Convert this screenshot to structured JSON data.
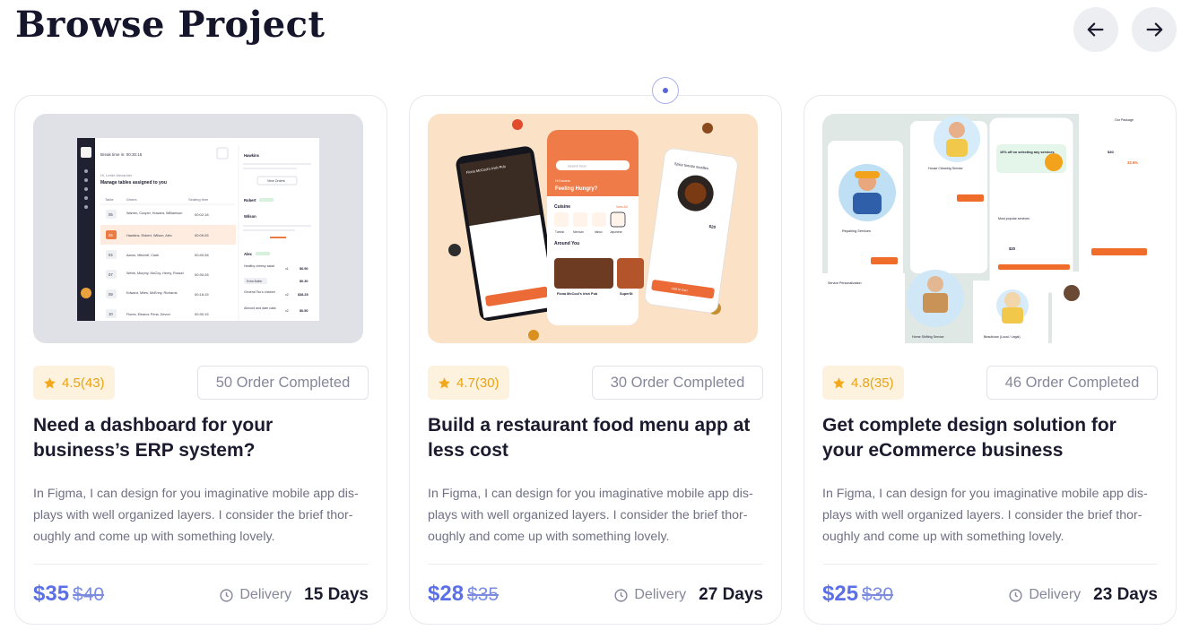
{
  "header": {
    "title": "Browse Project"
  },
  "nav": {
    "prev_icon": "arrow-left-icon",
    "next_icon": "arrow-right-icon"
  },
  "colors": {
    "accent": "#5b6fe8",
    "rating_bg": "#fdf2de",
    "rating_star": "#f3a81b",
    "card_border": "#e8e8ee"
  },
  "cards": [
    {
      "rating": "4.5(43)",
      "orders": "50 Order Completed",
      "title": "Need a dashboard for your business’s ERP system?",
      "description": "In Figma, I can design for you imaginative mobile app dis-plays with well organized layers. I consider the brief thor-oughly and come up with something lovely.",
      "price": "$35",
      "old_price": "$40",
      "delivery_label": "Delivery",
      "delivery_days": "15 Days",
      "thumb": {
        "header": "Break time in: 00:30:15",
        "greeting": "Hi, Leslie Alexander",
        "heading": "Manage tables assigned to you",
        "col_table": "Table",
        "col_diners": "Diners",
        "col_seating": "Seating time",
        "rows": [
          {
            "num": "05",
            "diners": "Warren, Cooper, Howard, Williamson",
            "time": "00:02:18"
          },
          {
            "num": "06",
            "diners": "Hawkins, Robert, Wilson, Alex",
            "time": "00:09:25"
          },
          {
            "num": "04",
            "diners": "Aaron, Mitchell, Clark",
            "time": "00:40:28"
          },
          {
            "num": "07",
            "diners": "Webb, Murphy, McCoy, Henry, Russel",
            "time": "00:30:28"
          },
          {
            "num": "09",
            "diners": "Edward, Miles, McEnny, Richards",
            "time": "00:18:15"
          },
          {
            "num": "10",
            "diners": "Flores, Eleanor Pena, Devon",
            "time": "00:30:15"
          }
        ],
        "side_names": [
          "Hawkins",
          "Robert",
          "Wilson",
          "Alex"
        ],
        "side_button": "View Orders",
        "side_items": [
          {
            "name": "Healthy cheesy salad",
            "qty": "x1",
            "price": "$6.90"
          },
          {
            "name": "Extra Butter",
            "qty": "",
            "price": "$0.30"
          },
          {
            "name": "General Tso's chicken",
            "qty": "x2",
            "price": "$38.25"
          },
          {
            "name": "Almond and date cake",
            "qty": "x2",
            "price": "$0.50"
          }
        ]
      }
    },
    {
      "rating": "4.7(30)",
      "orders": "30 Order Completed",
      "title": "Build a restaurant food menu app at less cost",
      "description": "In Figma, I can design for you imaginative mobile app dis-plays with well organized layers. I consider the brief thor-oughly and come up with something lovely.",
      "price": "$28",
      "old_price": "$35",
      "delivery_label": "Delivery",
      "delivery_days": "27 Days",
      "thumb": {
        "search": "Search food",
        "greeting": "Hi Daniela",
        "headline": "Feeling Hungry?",
        "cuisine": "Cuisine",
        "view_all": "View All",
        "cuisines": [
          "Turkish",
          "Mexican",
          "Italian",
          "Japanese"
        ],
        "around": "Around You",
        "restaurant": "Fiona McCool's Irish Pub",
        "restaurant2": "SuperSt",
        "dish": "Spicy tomato noodles",
        "dish_price": "$20",
        "left_title": "Fiona McCool's Irish Pub",
        "cart_btn": "Add to Cart"
      }
    },
    {
      "rating": "4.8(35)",
      "orders": "46 Order Completed",
      "title": "Get complete design solution for your eCommerce business",
      "description": "In Figma, I can design for you imaginative mobile app dis-plays with well organized layers. I consider the brief thor-oughly and come up with something lovely.",
      "price": "$25",
      "old_price": "$30",
      "delivery_label": "Delivery",
      "delivery_days": "23 Days",
      "thumb": {
        "service1": "Repairing Services",
        "service2": "House Cleaning Service",
        "service3": "Home Shifting Service",
        "service4": "Beautician (Local / Legal)",
        "promo": "10% off on selecting any services",
        "plan": "Our Package",
        "popular": "Most popular services",
        "price": "$20",
        "price2": "$30",
        "discount": "33.6%",
        "personalize": "Service Personalization"
      }
    }
  ]
}
